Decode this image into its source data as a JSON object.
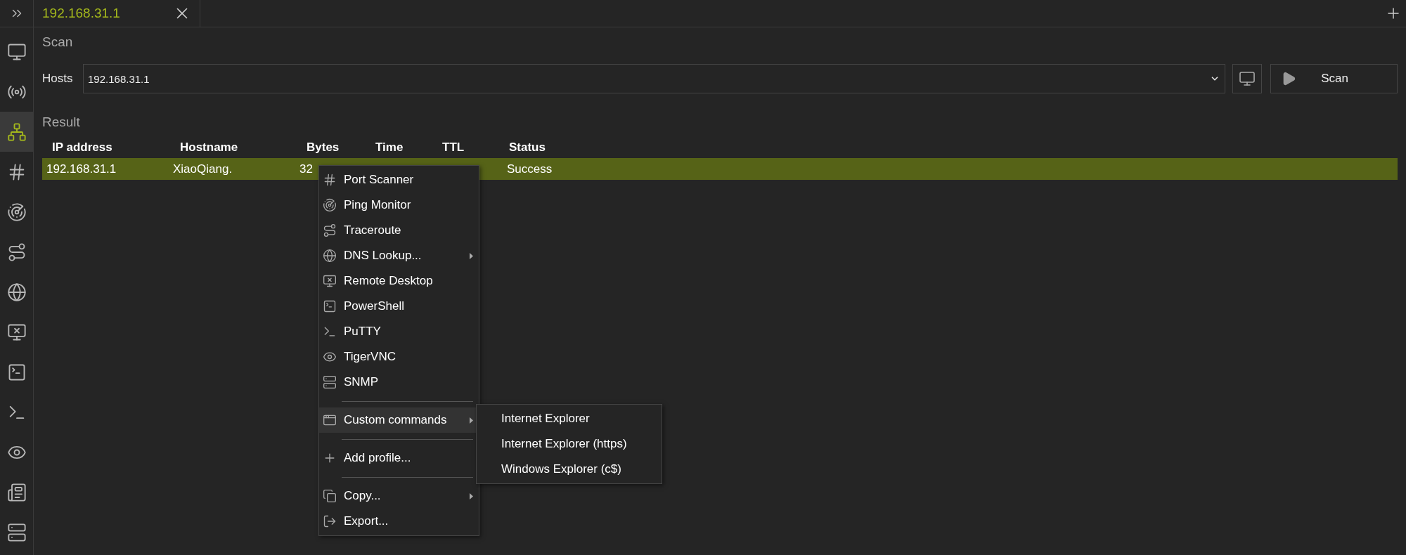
{
  "tab": {
    "title": "192.168.31.1",
    "selected": true
  },
  "sidebar": {
    "items": [
      {
        "kind": "ip-scanner",
        "selected": false
      },
      {
        "kind": "wifi",
        "selected": false
      },
      {
        "kind": "network",
        "selected": true
      },
      {
        "kind": "port",
        "selected": false
      },
      {
        "kind": "ping",
        "selected": false
      },
      {
        "kind": "trace",
        "selected": false
      },
      {
        "kind": "dns",
        "selected": false
      },
      {
        "kind": "remote",
        "selected": false
      },
      {
        "kind": "powershell",
        "selected": false
      },
      {
        "kind": "terminal",
        "selected": false
      },
      {
        "kind": "vnc",
        "selected": false
      },
      {
        "kind": "info",
        "selected": false
      },
      {
        "kind": "snmp",
        "selected": false
      }
    ]
  },
  "scan": {
    "heading": "Scan",
    "hosts_label": "Hosts",
    "hosts_value": "192.168.31.1",
    "scan_button": "Scan"
  },
  "result": {
    "heading": "Result",
    "columns": [
      "IP address",
      "Hostname",
      "Bytes",
      "Time",
      "TTL",
      "Status"
    ],
    "rows": [
      {
        "cells": [
          "192.168.31.1",
          "XiaoQiang.",
          "32",
          null,
          null,
          "Success"
        ],
        "selected": true
      }
    ]
  },
  "context_menu": {
    "items": [
      {
        "kind": "port",
        "label": "Port Scanner",
        "submenu": false,
        "selected": false
      },
      {
        "kind": "ping",
        "label": "Ping Monitor",
        "submenu": false,
        "selected": false
      },
      {
        "kind": "trace",
        "label": "Traceroute",
        "submenu": false,
        "selected": false
      },
      {
        "kind": "dns",
        "label": "DNS Lookup...",
        "submenu": true,
        "selected": false
      },
      {
        "kind": "remote",
        "label": "Remote Desktop",
        "submenu": false,
        "selected": false
      },
      {
        "kind": "powershell",
        "label": "PowerShell",
        "submenu": false,
        "selected": false
      },
      {
        "kind": "terminal",
        "label": "PuTTY",
        "submenu": false,
        "selected": false
      },
      {
        "kind": "vnc",
        "label": "TigerVNC",
        "submenu": false,
        "selected": false
      },
      {
        "kind": "snmp",
        "label": "SNMP",
        "submenu": false,
        "selected": false
      },
      {
        "kind": "separator"
      },
      {
        "kind": "window",
        "label": "Custom commands",
        "submenu": true,
        "selected": true
      },
      {
        "kind": "separator"
      },
      {
        "kind": "plus",
        "label": "Add profile...",
        "submenu": false,
        "selected": false
      },
      {
        "kind": "separator"
      },
      {
        "kind": "copy",
        "label": "Copy...",
        "submenu": true,
        "selected": false
      },
      {
        "kind": "export",
        "label": "Export...",
        "submenu": false,
        "selected": false
      }
    ],
    "submenu": [
      "Internet Explorer",
      "Internet Explorer (https)",
      "Windows Explorer (c$)"
    ]
  }
}
